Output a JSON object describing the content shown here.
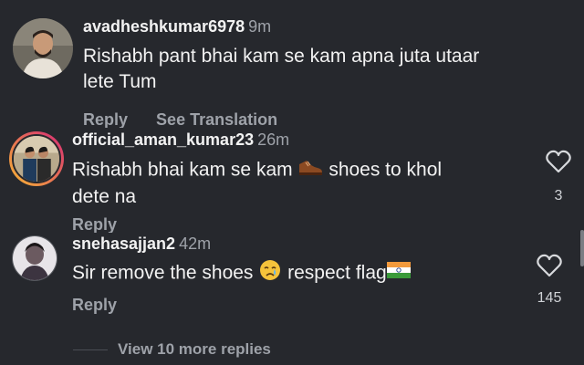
{
  "comments": [
    {
      "username": "avadheshkumar6978",
      "time": "9m",
      "text_line1": "Rishabh pant bhai kam se kam apna juta utaar",
      "text_line2": "lete Tum",
      "reply_label": "Reply",
      "translate_label": "See Translation",
      "avatar_icon": "profile-photo"
    },
    {
      "username": "official_aman_kumar23",
      "time": "26m",
      "text_before_emoji": "Rishabh bhai kam se kam",
      "emoji": "shoe-emoji",
      "text_after_emoji": "shoes to khol",
      "text_line2": "dete na",
      "reply_label": "Reply",
      "like_count": "3",
      "avatar_icon": "profile-photo"
    },
    {
      "username": "snehasajjan2",
      "time": "42m",
      "text_before_emoji": "Sir remove the  shoes",
      "emoji": "crying-face-emoji",
      "text_after_emoji": "respect flag",
      "flag_emoji": "india-flag-emoji",
      "reply_label": "Reply",
      "like_count": "145",
      "avatar_icon": "profile-photo"
    }
  ],
  "view_more_label": "View 10 more replies",
  "colors": {
    "background": "#26282d",
    "text": "#f2f2f2",
    "muted": "#9ea2a9",
    "story_ring_start": "#f7b733",
    "story_ring_end": "#d62976"
  }
}
